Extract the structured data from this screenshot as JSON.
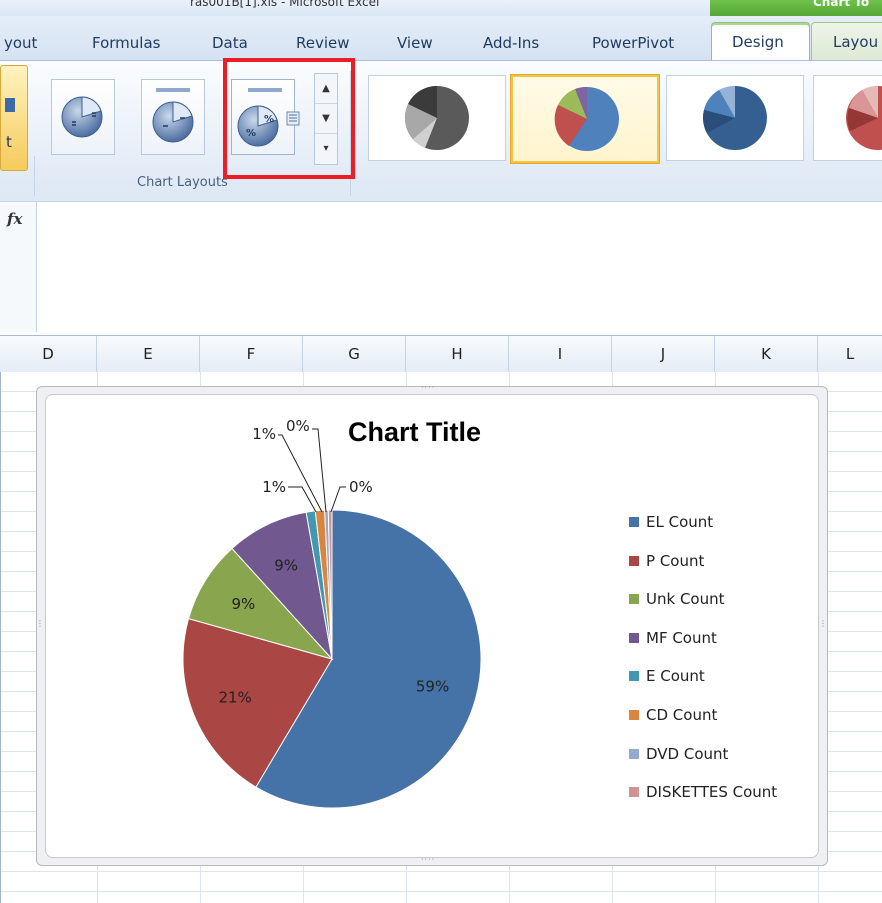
{
  "window": {
    "title": "ras001B[1].xls - Microsoft Excel",
    "contextual_tools": "Chart To"
  },
  "tabs": {
    "layout_partial": "yout",
    "formulas": "Formulas",
    "data": "Data",
    "review": "Review",
    "view": "View",
    "addins": "Add-Ins",
    "powerpivot": "PowerPivot",
    "design": "Design",
    "layout2": "Layou"
  },
  "ribbon": {
    "left_stub_label": "t",
    "group_label": "Chart Layouts",
    "scroll_up": "▲",
    "scroll_down": "▼",
    "scroll_more": "▾",
    "layout_icon_text": "%"
  },
  "formula_bar": {
    "fx_label": "fx",
    "value": ""
  },
  "columns": [
    "D",
    "E",
    "F",
    "G",
    "H",
    "I",
    "J",
    "K",
    "L"
  ],
  "chart_data": {
    "type": "pie",
    "title": "Chart Title",
    "categories": [
      "EL Count",
      "P Count",
      "Unk Count",
      "MF Count",
      "E Count",
      "CD Count",
      "DVD Count",
      "DISKETTES Count"
    ],
    "values": [
      59,
      21,
      9,
      9,
      1,
      1,
      0,
      0
    ],
    "labels": [
      "59%",
      "21%",
      "9%",
      "9%",
      "1%",
      "1%",
      "0%",
      "0%"
    ],
    "colors": [
      "#4572A7",
      "#AA4643",
      "#89A54E",
      "#71588F",
      "#4198AF",
      "#DB843D",
      "#93A9CF",
      "#D19392"
    ],
    "legend_position": "right"
  },
  "chart_styles": {
    "selected_index": 1
  }
}
